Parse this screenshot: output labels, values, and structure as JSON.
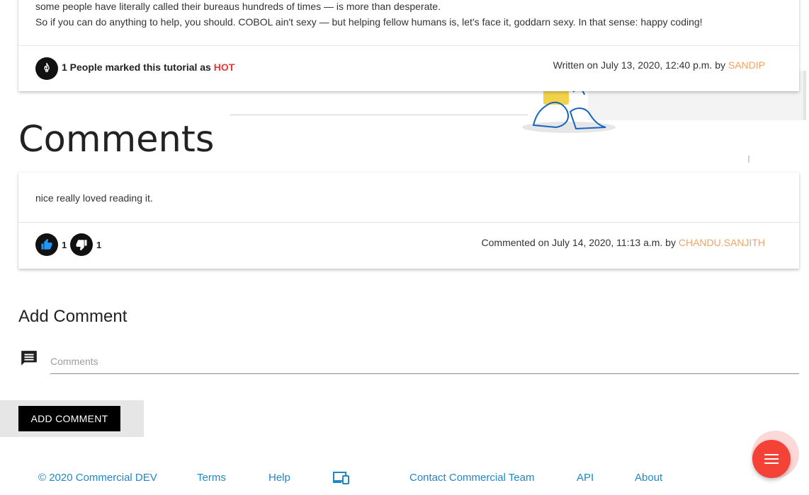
{
  "article": {
    "line1": "some people have literally called their bureaus hundreds of times — is more than desperate.",
    "line2": "So if you can do anything to help, you should. COBOL ain't sexy — but helping fellow humans is, let's face it, goddarn sexy. In that sense: happy coding!",
    "hot_prefix": "1 People marked this tutorial as ",
    "hot_word": "HOT",
    "written_prefix": "Written on July 13, 2020, 12:40 p.m. by ",
    "author": "SANDIP"
  },
  "comments": {
    "title": "Comments",
    "items": [
      {
        "text": "nice really loved reading it.",
        "likes": "1",
        "dislikes": "1",
        "meta_prefix": "Commented on July 14, 2020, 11:13 a.m. by ",
        "author": "CHANDU.SANJITH"
      }
    ]
  },
  "add_comment": {
    "title": "Add Comment",
    "placeholder": "Comments",
    "button_label": "ADD COMMENT"
  },
  "footer": {
    "copyright": "© 2020 Commercial DEV",
    "terms": "Terms",
    "help": "Help",
    "contact": "Contact Commercial Team",
    "api": "API",
    "about": "About"
  },
  "icons": {
    "hot": "flame-icon",
    "like": "thumbs-up-icon",
    "dislike": "thumbs-down-icon",
    "comment_field": "comment-icon",
    "devices": "devices-icon",
    "fab": "menu-icon"
  },
  "colors": {
    "accent_hot": "#e53935",
    "author": "#f4a261",
    "link": "#1e88c7",
    "fab": "#f44336"
  }
}
